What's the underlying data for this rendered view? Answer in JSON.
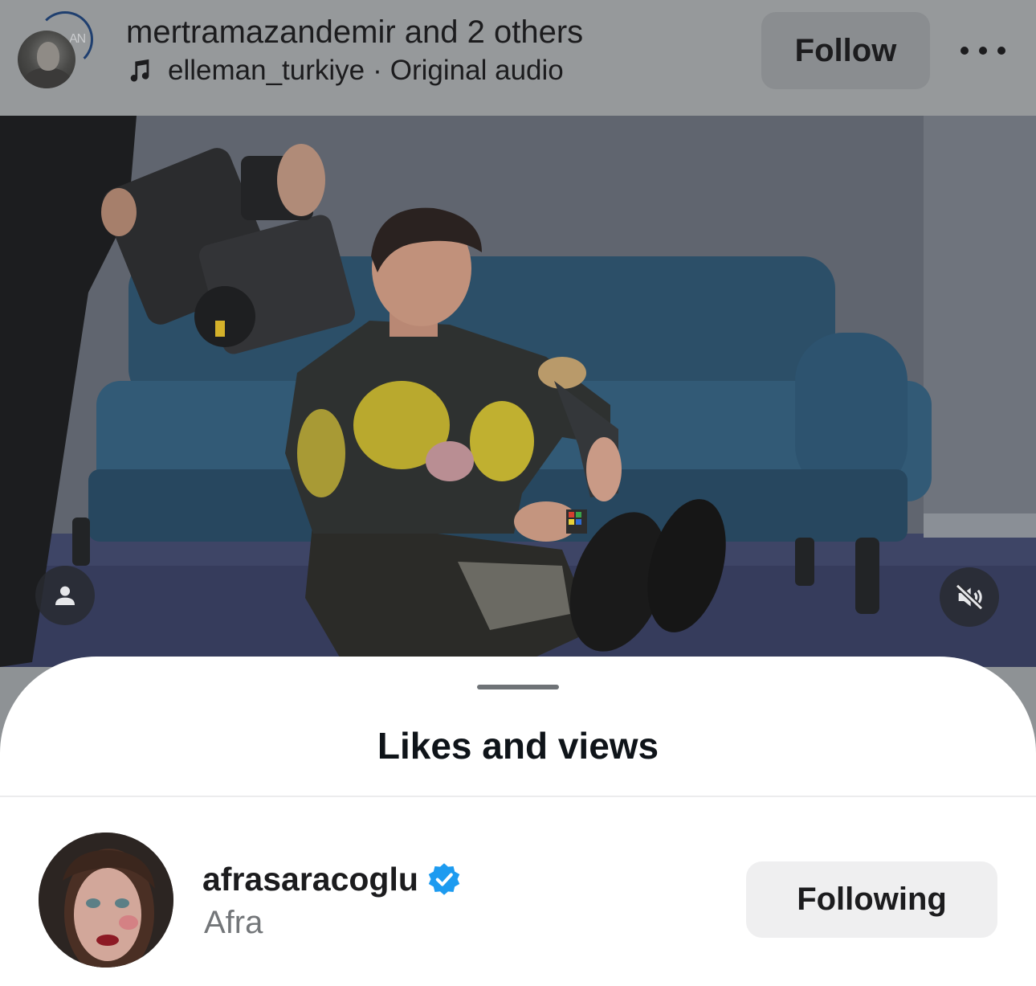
{
  "header": {
    "author_names": "mertramazandemir and 2 others",
    "avatar_ring_text": "AN",
    "audio_account": "elleman_turkiye",
    "audio_separator": "·",
    "audio_title": "Original audio",
    "follow_label": "Follow",
    "more_icon": "more-horizontal-icon"
  },
  "video": {
    "profile_icon": "person-icon",
    "mute_icon": "speaker-muted-icon"
  },
  "sheet": {
    "title": "Likes and views",
    "users": [
      {
        "username": "afrasaracoglu",
        "verified": true,
        "full_name": "Afra",
        "button_label": "Following"
      }
    ]
  },
  "colors": {
    "header_dim": "#96999b",
    "verified_blue": "#1d9bf0",
    "secondary_text": "#737679",
    "button_gray": "#efeff0"
  }
}
